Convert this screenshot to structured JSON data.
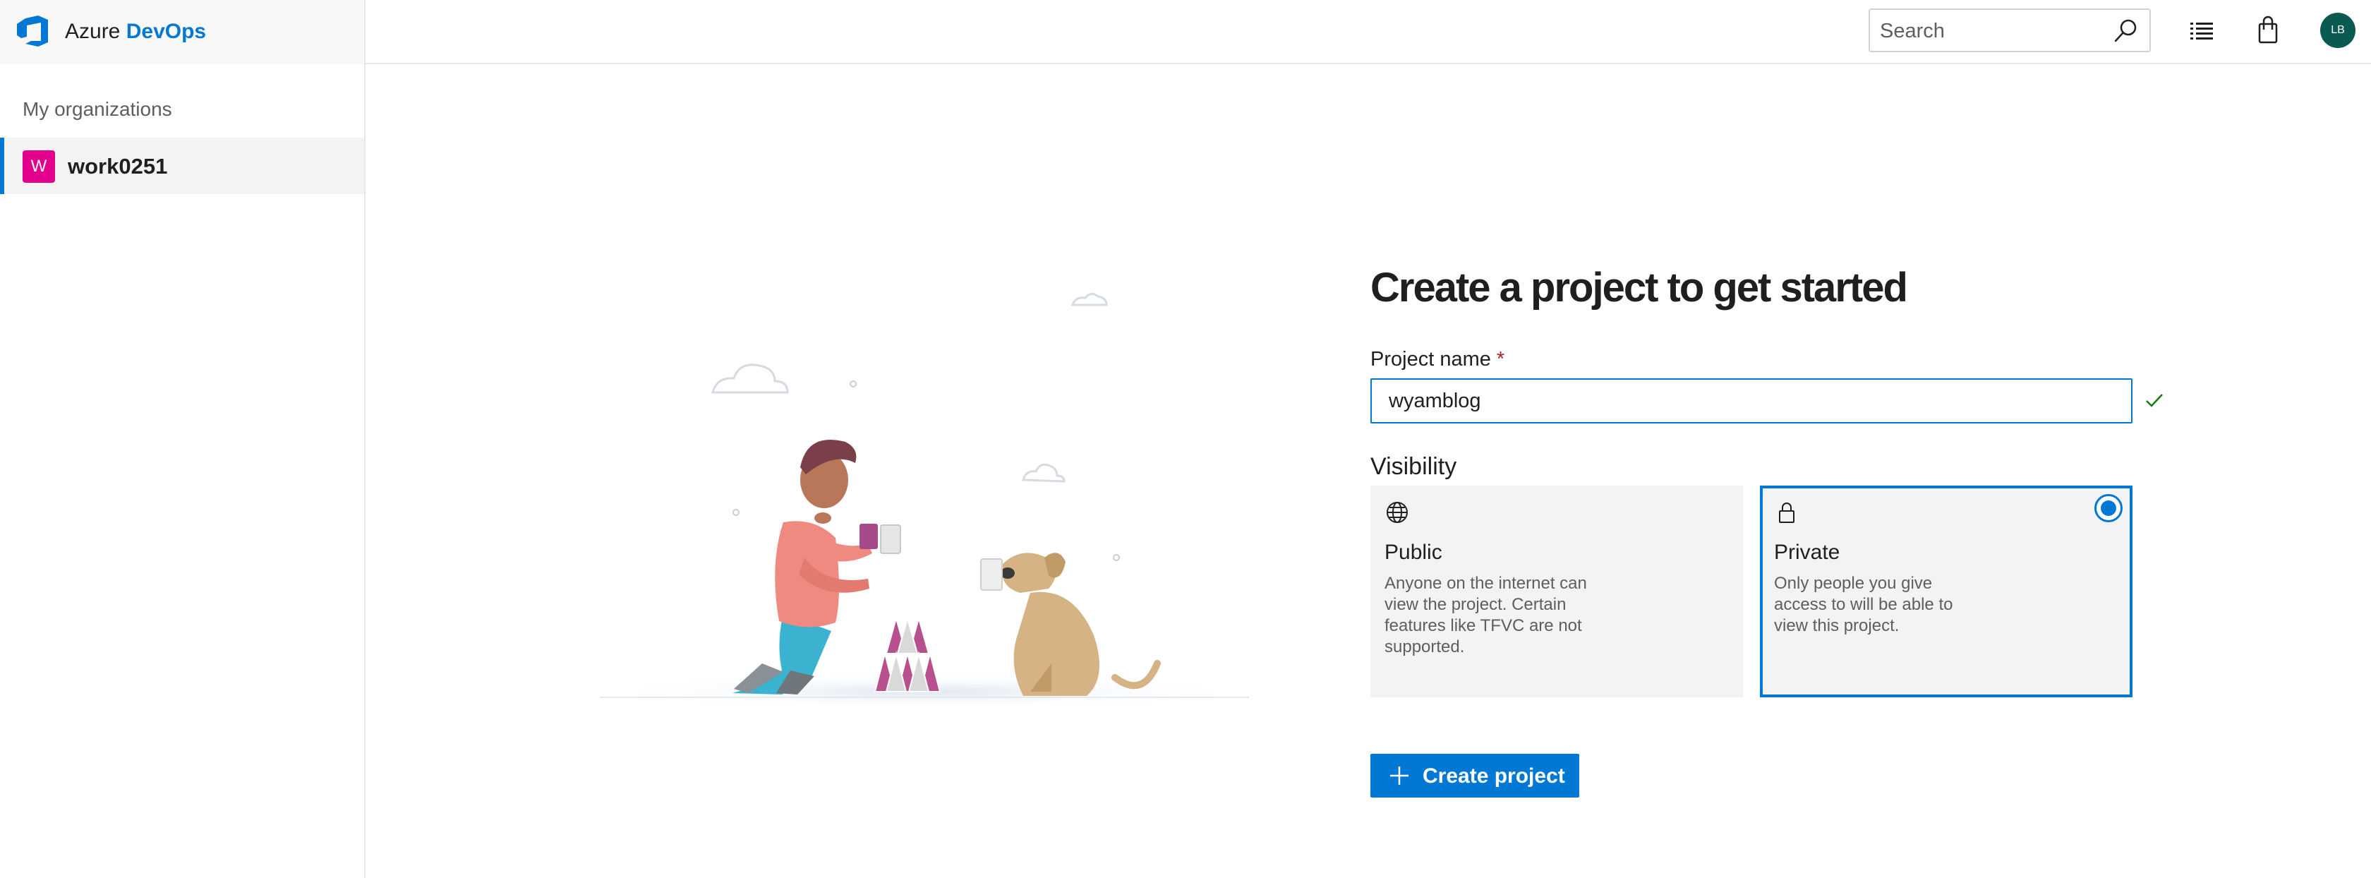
{
  "header": {
    "brand_name": "Azure",
    "brand_accent": "DevOps",
    "search_placeholder": "Search",
    "user_initials": "LB"
  },
  "sidebar": {
    "heading": "My organizations",
    "organizations": [
      {
        "initial": "W",
        "name": "work0251",
        "selected": true
      }
    ]
  },
  "main": {
    "title": "Create a project to get started",
    "project_name_label": "Project name",
    "required_marker": "*",
    "project_name_value": "wyamblog",
    "visibility_label": "Visibility",
    "visibility_options": [
      {
        "title": "Public",
        "description": "Anyone on the internet can view the project. Certain features like TFVC are not supported.",
        "icon": "globe-icon",
        "selected": false
      },
      {
        "title": "Private",
        "description": "Only people you give access to will be able to view this project.",
        "icon": "lock-icon",
        "selected": true
      }
    ],
    "create_button_label": "Create project"
  },
  "colors": {
    "accent": "#0078d4",
    "org_badge": "#e3008c",
    "avatar": "#0b5a52",
    "required": "#a4262c",
    "valid_check": "#107c10"
  }
}
